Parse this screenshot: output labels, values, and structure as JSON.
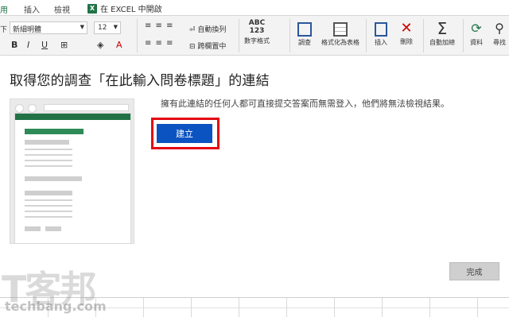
{
  "ribbon": {
    "tabs": [
      {
        "label": "用",
        "kind": "file"
      },
      {
        "label": "插入"
      },
      {
        "label": "檢視"
      }
    ],
    "open_in_excel": {
      "icon": "X",
      "label": "在 EXCEL 中開啟"
    },
    "font_label": "下",
    "font_name": "新細明體",
    "font_size": "12",
    "wrap_text": "自動換列",
    "merge_center": "跨欄置中",
    "number_format_icon": "ABC\n123",
    "number_format": "數字格式",
    "survey": "調查",
    "format_as_table": "格式化為表格",
    "insert": "插入",
    "delete": "刪除",
    "autosum": "自動加總",
    "data": "資料",
    "find": "尋找"
  },
  "dialog": {
    "title": "取得您的調查「在此輸入問卷標題」的連結",
    "info": "擁有此連結的任何人都可直接提交答案而無需登入，他們將無法檢視結果。",
    "create_label": "建立",
    "done_label": "完成"
  },
  "watermark": {
    "logo": "T客邦",
    "url": "techbang.com"
  },
  "colors": {
    "excel_green": "#217346",
    "create_blue": "#0b53c1",
    "highlight_red": "#e30613"
  }
}
